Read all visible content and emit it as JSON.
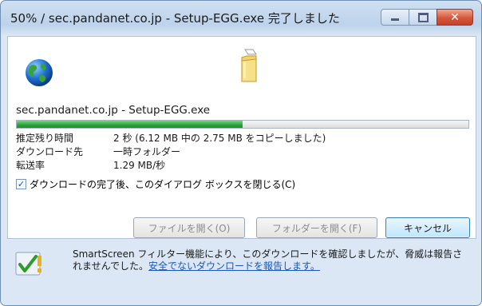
{
  "window": {
    "title": "50% / sec.pandanet.co.jp - Setup-EGG.exe 完了しました",
    "close_glyph": "✕"
  },
  "download": {
    "filename": "sec.pandanet.co.jp - Setup-EGG.exe",
    "progress_fraction": 0.5,
    "rows": [
      {
        "key": "推定残り時間",
        "value": "2 秒 (6.12 MB 中の 2.75 MB をコピーしました)"
      },
      {
        "key": "ダウンロード先",
        "value": "一時フォルダー"
      },
      {
        "key": "転送率",
        "value": "1.29 MB/秒"
      }
    ],
    "close_checkbox": {
      "checked": true,
      "mark": "✓",
      "label": "ダウンロードの完了後、このダイアログ ボックスを閉じる(C)"
    }
  },
  "buttons": {
    "open_file": "ファイルを開く(O)",
    "open_folder": "フォルダーを開く(F)",
    "cancel": "キャンセル"
  },
  "smartscreen": {
    "text": "SmartScreen フィルター機能により、このダウンロードを確認しましたが、脅威は報告されませんでした。",
    "link": "安全でないダウンロードを報告します。"
  },
  "colors": {
    "progress": "#27a33a",
    "link": "#1b58b8",
    "accent": "#3c7fb1"
  }
}
